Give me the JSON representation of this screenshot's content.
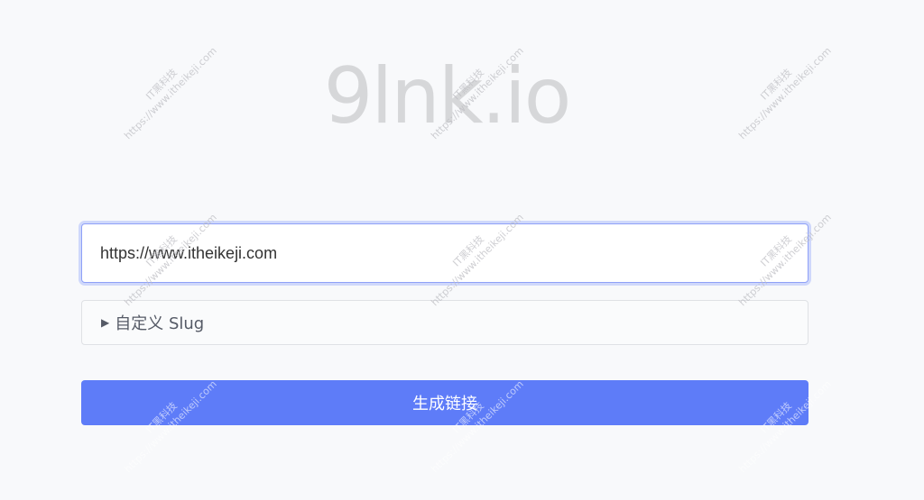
{
  "logo": {
    "text": "9lnk.io"
  },
  "url_input": {
    "value": "https://www.itheikeji.com"
  },
  "slug_toggle": {
    "arrow": "▶",
    "label": "自定义 Slug"
  },
  "generate_button": {
    "label": "生成链接"
  },
  "watermark": {
    "line1": "IT黑科技",
    "line2": "https://www.itheikeji.com"
  },
  "colors": {
    "accent": "#5e7cf8",
    "logo": "#d6d7d9",
    "background": "#f8f9fb"
  }
}
